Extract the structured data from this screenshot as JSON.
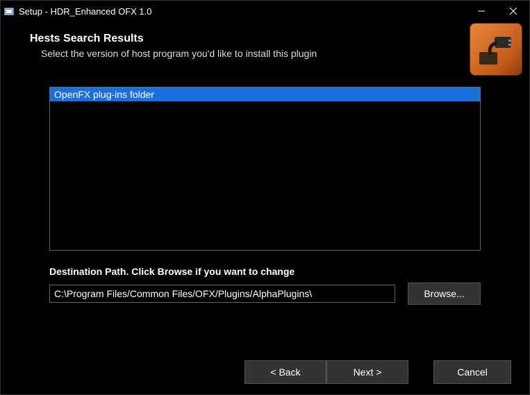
{
  "titlebar": {
    "title": "Setup - HDR_Enhanced OFX 1.0"
  },
  "header": {
    "title": "Hests Search Results",
    "subtitle": "Select the version of host program you'd like to install this plugin"
  },
  "list": {
    "items": [
      {
        "label": "OpenFX plug-ins folder",
        "selected": true
      }
    ]
  },
  "destination": {
    "label": "Destination Path. Click Browse if you want to change",
    "path": "C:\\Program Files/Common Files/OFX/Plugins/AlphaPlugins\\",
    "browse_label": "Browse..."
  },
  "footer": {
    "back_label": "< Back",
    "next_label": "Next >",
    "cancel_label": "Cancel"
  }
}
